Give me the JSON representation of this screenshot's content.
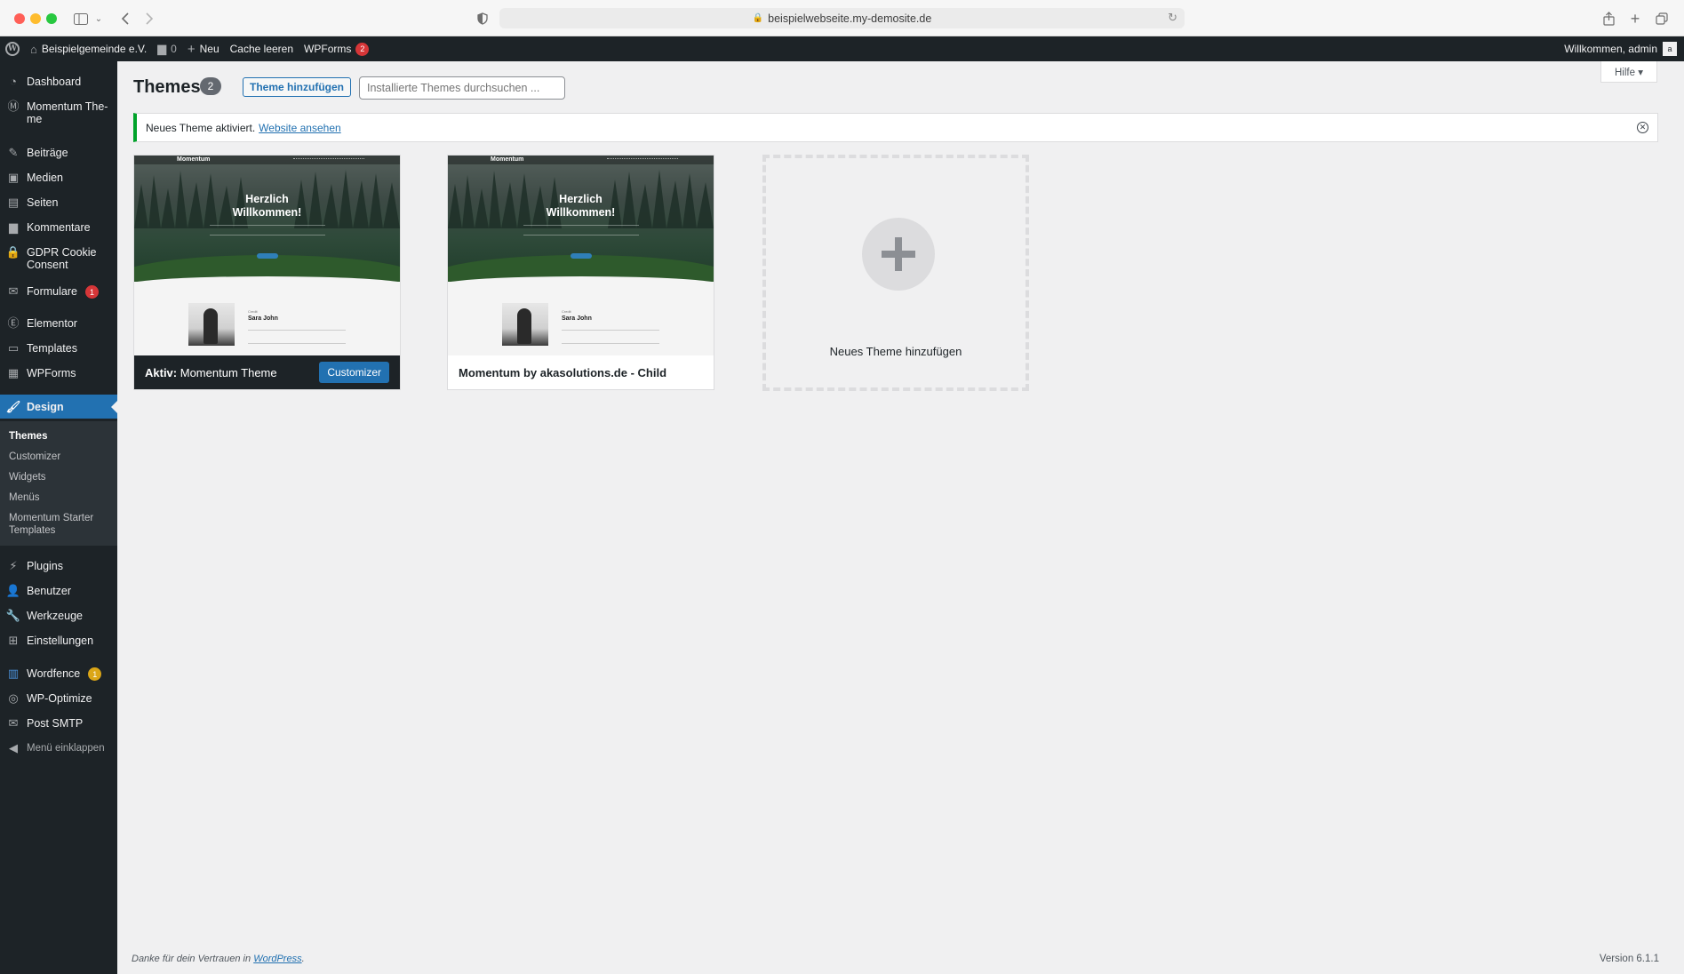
{
  "browser": {
    "url": "beispielwebseite.my-demosite.de"
  },
  "adminbar": {
    "site_name": "Beispielgemeinde e.V.",
    "comments_count": "0",
    "new_label": "Neu",
    "cache_label": "Cache leeren",
    "wpforms_label": "WPForms",
    "wpforms_badge": "2",
    "greeting": "Willkommen, admin"
  },
  "sidebar": {
    "items": {
      "dashboard": "Dashboard",
      "momentum": "Momentum The-me",
      "posts": "Beiträge",
      "media": "Medien",
      "pages": "Seiten",
      "comments": "Kommentare",
      "gdpr": "GDPR Cookie Consent",
      "forms": "Formulare",
      "forms_badge": "1",
      "elementor": "Elementor",
      "templates": "Templates",
      "wpforms": "WPForms",
      "design": "Design",
      "plugins": "Plugins",
      "users": "Benutzer",
      "tools": "Werkzeuge",
      "settings": "Einstellungen",
      "wordfence": "Wordfence",
      "wordfence_badge": "1",
      "wpoptimize": "WP-Optimize",
      "postsmtp": "Post SMTP",
      "collapse": "Menü einklappen"
    },
    "submenu": {
      "themes": "Themes",
      "customizer": "Customizer",
      "widgets": "Widgets",
      "menus": "Menüs",
      "starter": "Momentum Starter Templates"
    }
  },
  "page": {
    "help": "Hilfe ▾",
    "title": "Themes",
    "count": "2",
    "add_button": "Theme hinzufügen",
    "search_placeholder": "Installierte Themes durchsuchen ...",
    "notice_text": "Neues Theme aktiviert.",
    "notice_link": "Website ansehen"
  },
  "themes": [
    {
      "active_prefix": "Aktiv:",
      "name": "Momentum Theme",
      "button": "Customizer",
      "preview_title": "Herzlich Willkommen!",
      "preview_logo": "Momentum",
      "preview_person": "Sara John",
      "preview_credit": "Credit"
    },
    {
      "name": "Momentum by akasolutions.de - Child",
      "preview_title": "Herzlich Willkommen!",
      "preview_logo": "Momentum",
      "preview_person": "Sara John",
      "preview_credit": "Credit"
    }
  ],
  "add_theme_label": "Neues Theme hinzufügen",
  "footer": {
    "thanks": "Danke für dein Vertrauen in",
    "link": "WordPress",
    "version": "Version 6.1.1"
  },
  "colors": {
    "admin_dark": "#1d2327",
    "accent": "#2271b1",
    "success": "#00a32a",
    "badge_red": "#d63638"
  }
}
